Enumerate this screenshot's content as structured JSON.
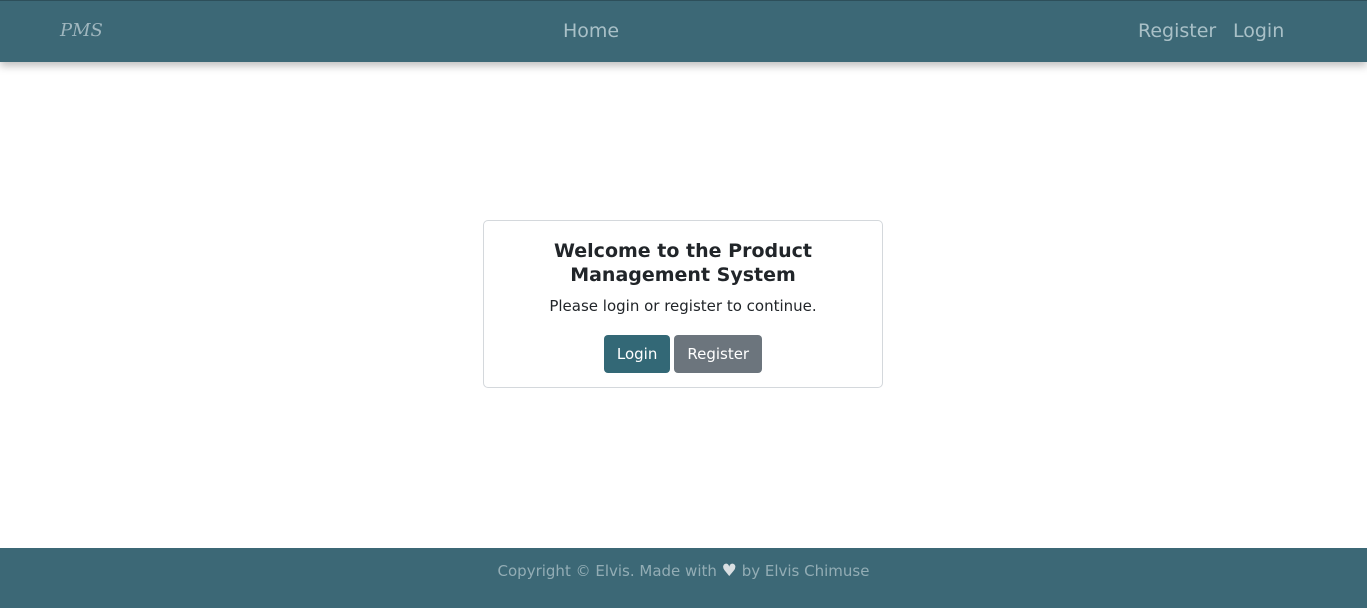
{
  "navbar": {
    "brand": "PMS",
    "home": "Home",
    "register": "Register",
    "login": "Login"
  },
  "card": {
    "title": "Welcome to the Product Management System",
    "text": "Please login or register to continue.",
    "login_button": "Login",
    "register_button": "Register"
  },
  "footer": {
    "before_heart": "Copyright © Elvis. Made with",
    "heart_icon": "♥",
    "after_heart": "by Elvis Chimuse"
  },
  "colors": {
    "navbar_bg": "#3c6876",
    "primary_button": "#336876",
    "secondary_button": "#6c757d"
  }
}
